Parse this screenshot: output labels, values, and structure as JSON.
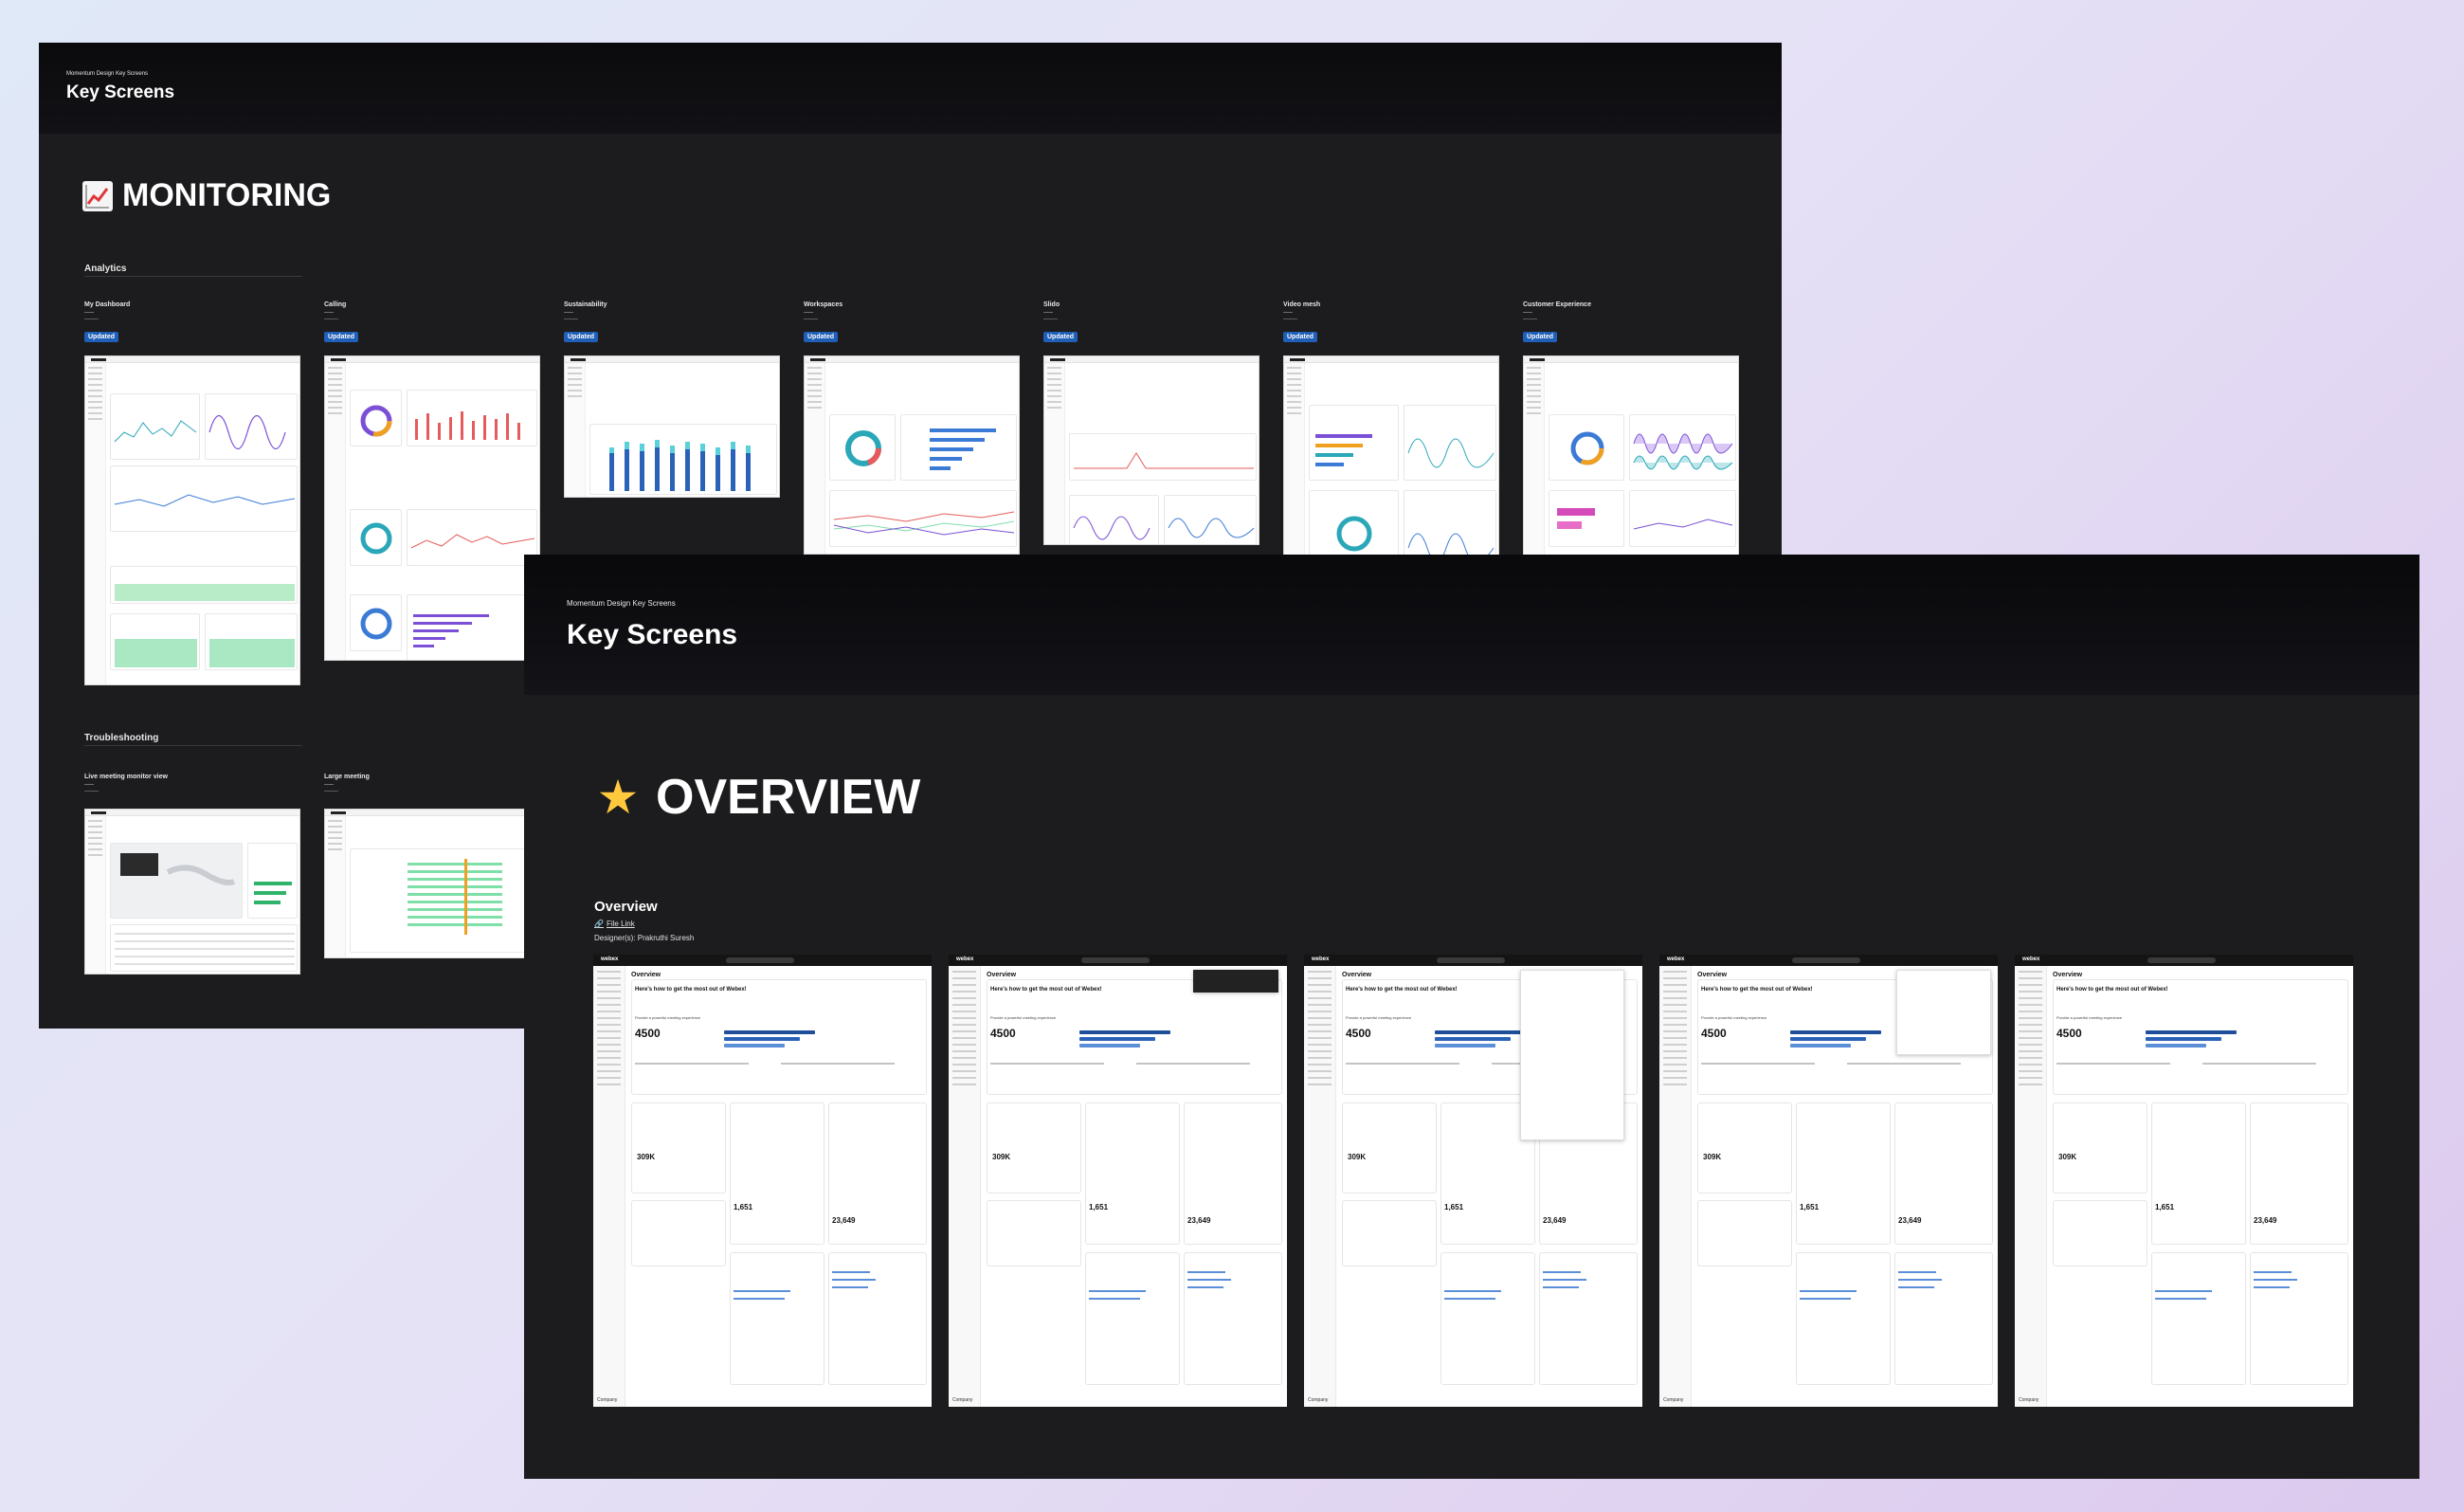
{
  "monitoring": {
    "kicker": "Momentum Design Key Screens",
    "title": "Key Screens",
    "section_title": "MONITORING",
    "section_icon": "chart-increasing-icon",
    "analytics_label": "Analytics",
    "troubleshooting_label": "Troubleshooting",
    "items": [
      {
        "title": "My Dashboard",
        "badge": "Updated"
      },
      {
        "title": "Calling",
        "badge": "Updated"
      },
      {
        "title": "Sustainability",
        "badge": "Updated"
      },
      {
        "title": "Workspaces",
        "badge": "Updated"
      },
      {
        "title": "Slido",
        "badge": "Updated"
      },
      {
        "title": "Video mesh",
        "badge": "Updated"
      },
      {
        "title": "Customer Experience",
        "badge": "Updated"
      }
    ],
    "troubleshooting_items": [
      {
        "title": "Live meeting monitor view"
      },
      {
        "title": "Large meeting"
      }
    ]
  },
  "overview": {
    "kicker": "Momentum Design Key Screens",
    "title": "Key Screens",
    "section_title": "OVERVIEW",
    "section_icon": "star-icon",
    "star_glyph": "★",
    "group_title": "Overview",
    "file_link": "File Link",
    "designer": "Designer(s): Prakruthi Suresh",
    "screen": {
      "brand": "webex",
      "heading": "Overview",
      "welcome": "Here's how to get the most out of Webex!",
      "tagline": "Provide a powerful meeting experience",
      "big_number": "4500",
      "people_number": "309K",
      "sessions_number": "1,651",
      "devices_number": "23,649",
      "footer": "Company"
    },
    "screens_count": 5
  },
  "colors": {
    "card_bg": "#1c1c1e",
    "badge_blue": "#1f5fb8",
    "accent_green": "#7fdfa8",
    "accent_purple": "#7b4fd6",
    "accent_teal": "#2aa7b8"
  }
}
